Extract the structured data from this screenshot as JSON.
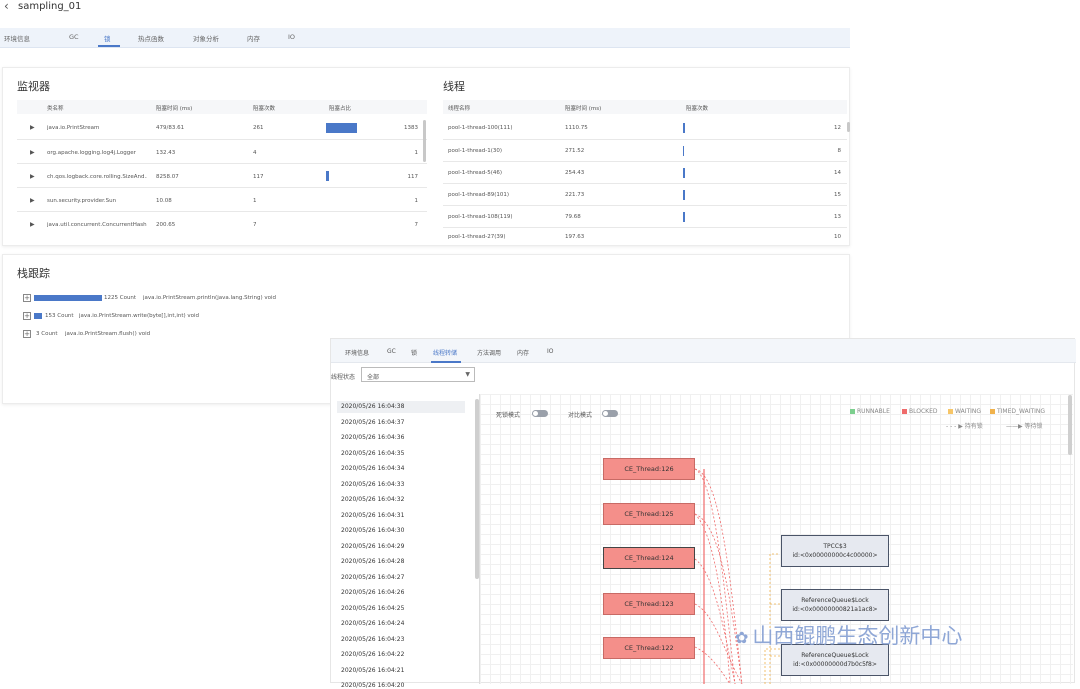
{
  "header": {
    "back_icon": "chevron-left-icon",
    "title": "sampling_01"
  },
  "tabs1": [
    "环境信息",
    "GC",
    "锁",
    "热点函数",
    "对象分析",
    "内存",
    "IO"
  ],
  "monitor": {
    "title": "监视器",
    "columns": [
      "类名称",
      "阻塞时间 (ms)",
      "阻塞次数",
      "阻塞占比"
    ],
    "rows": [
      {
        "name": "java.io.PrintStream",
        "time": "479/83.61",
        "count": "261",
        "pct": "1383"
      },
      {
        "name": "org.apache.logging.log4j.Logger",
        "time": "132.43",
        "count": "4",
        "pct": "1"
      },
      {
        "name": "ch.qos.logback.core.rolling.SizeAnd...",
        "time": "8258.07",
        "count": "117",
        "pct": "117"
      },
      {
        "name": "sun.security.provider.Sun",
        "time": "10.08",
        "count": "1",
        "pct": "1"
      },
      {
        "name": "java.util.concurrent.ConcurrentHash...",
        "time": "200.65",
        "count": "7",
        "pct": "7"
      }
    ]
  },
  "threads": {
    "title": "线程",
    "columns": [
      "线程名称",
      "阻塞时间 (ms)",
      "阻塞次数"
    ],
    "rows": [
      {
        "name": "pool-1-thread-100(111)",
        "time": "1110.75",
        "count": "12"
      },
      {
        "name": "pool-1-thread-1(30)",
        "time": "271.52",
        "count": "8"
      },
      {
        "name": "pool-1-thread-5(46)",
        "time": "254.43",
        "count": "14"
      },
      {
        "name": "pool-1-thread-89(101)",
        "time": "221.73",
        "count": "15"
      },
      {
        "name": "pool-1-thread-108(119)",
        "time": "79.68",
        "count": "13"
      },
      {
        "name": "pool-1-thread-27(39)",
        "time": "197.63",
        "count": "10"
      }
    ]
  },
  "stack": {
    "title": "栈跟踪",
    "rows": [
      {
        "count": "1225 Count",
        "text": "java.io.PrintStream.println(java.lang.String) void",
        "fill": 1.0
      },
      {
        "count": "153 Count",
        "text": "java.io.PrintStream.write(byte[],int,int) void",
        "fill": 0.12
      },
      {
        "count": "3 Count",
        "text": "java.io.PrintStream.flush() void",
        "fill": 0
      }
    ]
  },
  "tabs2": [
    "环境信息",
    "GC",
    "锁",
    "线程转储",
    "方法调用",
    "内存",
    "IO"
  ],
  "filter": {
    "label": "线程状态",
    "value": "全部"
  },
  "times": [
    "2020/05/26 16:04:38",
    "2020/05/26 16:04:37",
    "2020/05/26 16:04:36",
    "2020/05/26 16:04:35",
    "2020/05/26 16:04:34",
    "2020/05/26 16:04:33",
    "2020/05/26 16:04:32",
    "2020/05/26 16:04:31",
    "2020/05/26 16:04:30",
    "2020/05/26 16:04:29",
    "2020/05/26 16:04:28",
    "2020/05/26 16:04:27",
    "2020/05/26 16:04:26",
    "2020/05/26 16:04:25",
    "2020/05/26 16:04:24",
    "2020/05/26 16:04:23",
    "2020/05/26 16:04:22",
    "2020/05/26 16:04:21",
    "2020/05/26 16:04:20"
  ],
  "toggles": [
    "死锁模式",
    "对比模式"
  ],
  "legend": [
    "RUNNABLE",
    "BLOCKED",
    "WAITING",
    "TIMED_WAITING"
  ],
  "legend_colors": [
    "#7ccf8e",
    "#ef6b6b",
    "#f7c668",
    "#f0b24c"
  ],
  "legend2": [
    "持有锁",
    "等待锁"
  ],
  "threads_nodes": [
    "CE_Thread:126",
    "CE_Thread:125",
    "CE_Thread:124",
    "CE_Thread:123",
    "CE_Thread:122"
  ],
  "locks": [
    {
      "name": "TPCC$3",
      "id": "id:<0x00000000c4c00000>"
    },
    {
      "name": "ReferenceQueue$Lock",
      "id": "id:<0x00000000821a1ac8>"
    },
    {
      "name": "ReferenceQueue$Lock",
      "id": "id:<0x00000000d7b0c5f8>"
    }
  ],
  "watermark": "山西鲲鹏生态创新中心"
}
